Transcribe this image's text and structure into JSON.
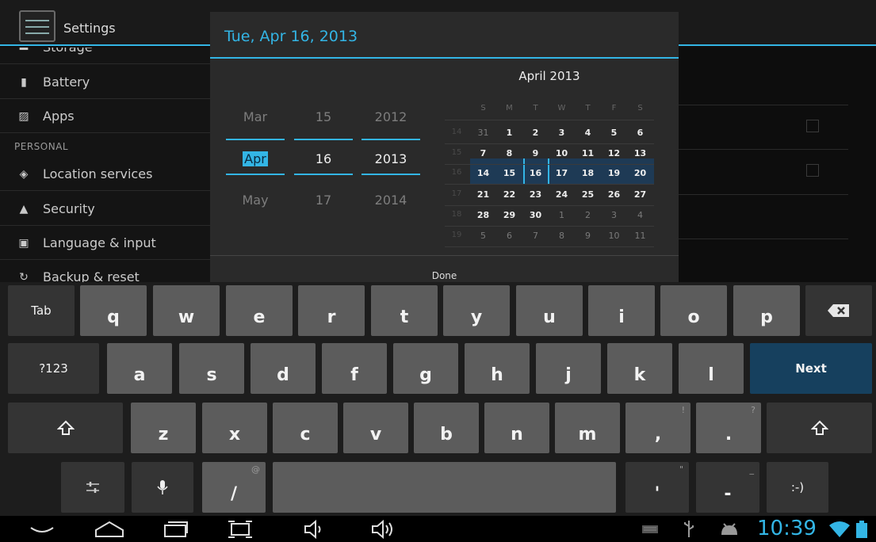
{
  "settings": {
    "title": "Settings",
    "items": [
      {
        "label": "Storage",
        "icon": "storage-icon"
      },
      {
        "label": "Battery",
        "icon": "battery-icon"
      },
      {
        "label": "Apps",
        "icon": "apps-icon"
      },
      {
        "label": "Location services",
        "icon": "location-icon"
      },
      {
        "label": "Security",
        "icon": "lock-icon"
      },
      {
        "label": "Language & input",
        "icon": "language-icon"
      },
      {
        "label": "Backup & reset",
        "icon": "backup-icon"
      }
    ],
    "section_personal": "PERSONAL"
  },
  "dialog": {
    "title": "Tue, Apr 16, 2013",
    "month": {
      "prev": "Mar",
      "current": "Apr",
      "next": "May"
    },
    "day": {
      "prev": "15",
      "current": "16",
      "next": "17"
    },
    "year": {
      "prev": "2012",
      "current": "2013",
      "next": "2014"
    },
    "done_label": "Done",
    "calendar": {
      "title": "April 2013",
      "day_names": [
        "S",
        "M",
        "T",
        "W",
        "T",
        "F",
        "S"
      ],
      "weeks": [
        "14",
        "15",
        "16",
        "17",
        "18",
        "19"
      ],
      "rows": [
        [
          "31",
          "1",
          "2",
          "3",
          "4",
          "5",
          "6"
        ],
        [
          "7",
          "8",
          "9",
          "10",
          "11",
          "12",
          "13"
        ],
        [
          "14",
          "15",
          "16",
          "17",
          "18",
          "19",
          "20"
        ],
        [
          "21",
          "22",
          "23",
          "24",
          "25",
          "26",
          "27"
        ],
        [
          "28",
          "29",
          "30",
          "1",
          "2",
          "3",
          "4"
        ],
        [
          "5",
          "6",
          "7",
          "8",
          "9",
          "10",
          "11"
        ]
      ],
      "selected_day": "16"
    }
  },
  "keyboard": {
    "row1": [
      "Tab",
      "q",
      "w",
      "e",
      "r",
      "t",
      "y",
      "u",
      "i",
      "o",
      "p"
    ],
    "row2": [
      "?123",
      "a",
      "s",
      "d",
      "f",
      "g",
      "h",
      "j",
      "k",
      "l",
      "Next"
    ],
    "row3": [
      "z",
      "x",
      "c",
      "v",
      "b",
      "n",
      "m",
      ",",
      "."
    ],
    "row3_hints": {
      "comma": "!",
      "period": "?"
    },
    "row4": {
      "slash": "/",
      "slash_hint": "@",
      "apostrophe": "'",
      "apostrophe_hint": "\"",
      "dash": "-",
      "dash_hint": "_",
      "smiley": ":-)"
    }
  },
  "status": {
    "time": "10:39"
  },
  "colors": {
    "accent": "#33b5e5",
    "selection": "#1e3a55",
    "next_key": "#16405e"
  }
}
